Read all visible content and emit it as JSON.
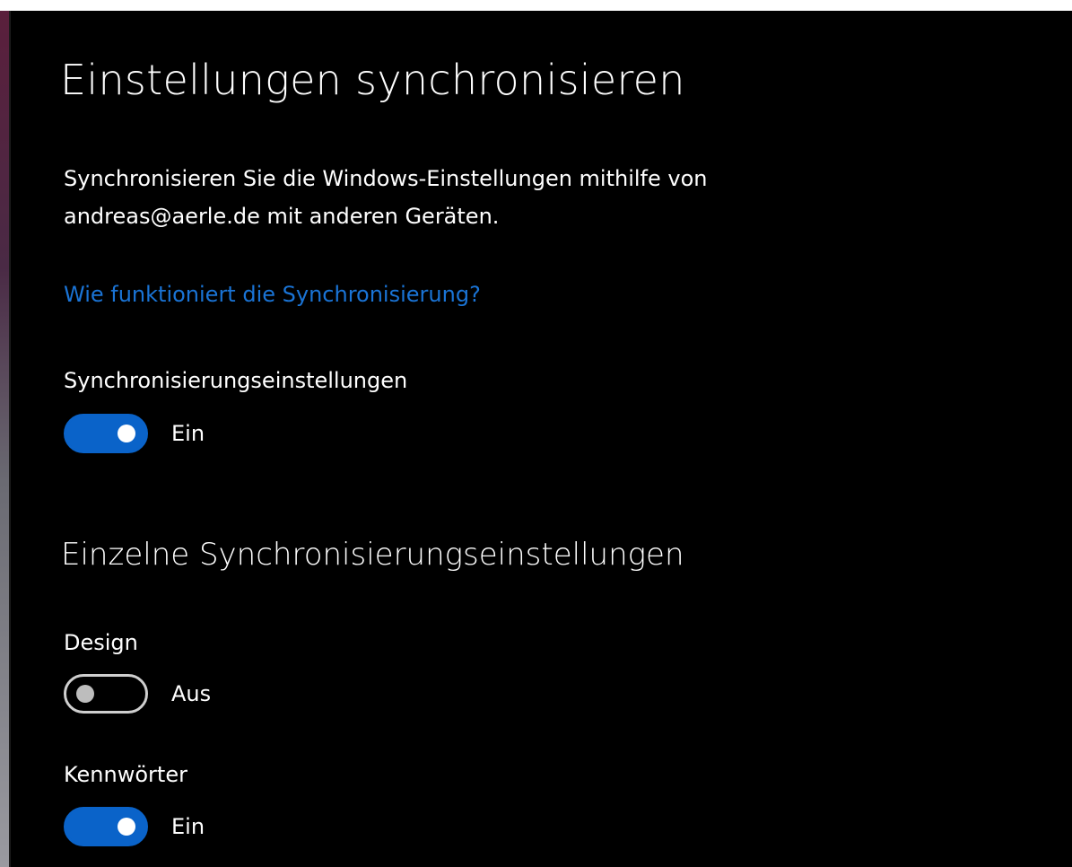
{
  "page": {
    "title": "Einstellungen synchronisieren",
    "description": "Synchronisieren Sie die Windows-Einstellungen mithilfe von andreas@aerle.de mit anderen Geräten.",
    "help_link": "Wie funktioniert die Synchronisierung?"
  },
  "sync_settings": {
    "label": "Synchronisierungseinstellungen",
    "state": "Ein",
    "on": true
  },
  "individual": {
    "heading": "Einzelne Synchronisierungseinstellungen",
    "items": [
      {
        "label": "Design",
        "state": "Aus",
        "on": false
      },
      {
        "label": "Kennwörter",
        "state": "Ein",
        "on": true
      }
    ]
  },
  "colors": {
    "background": "#000000",
    "accent": "#0a63c9",
    "link": "#1a74d6",
    "toggle_off_border": "#cfcfcf"
  }
}
